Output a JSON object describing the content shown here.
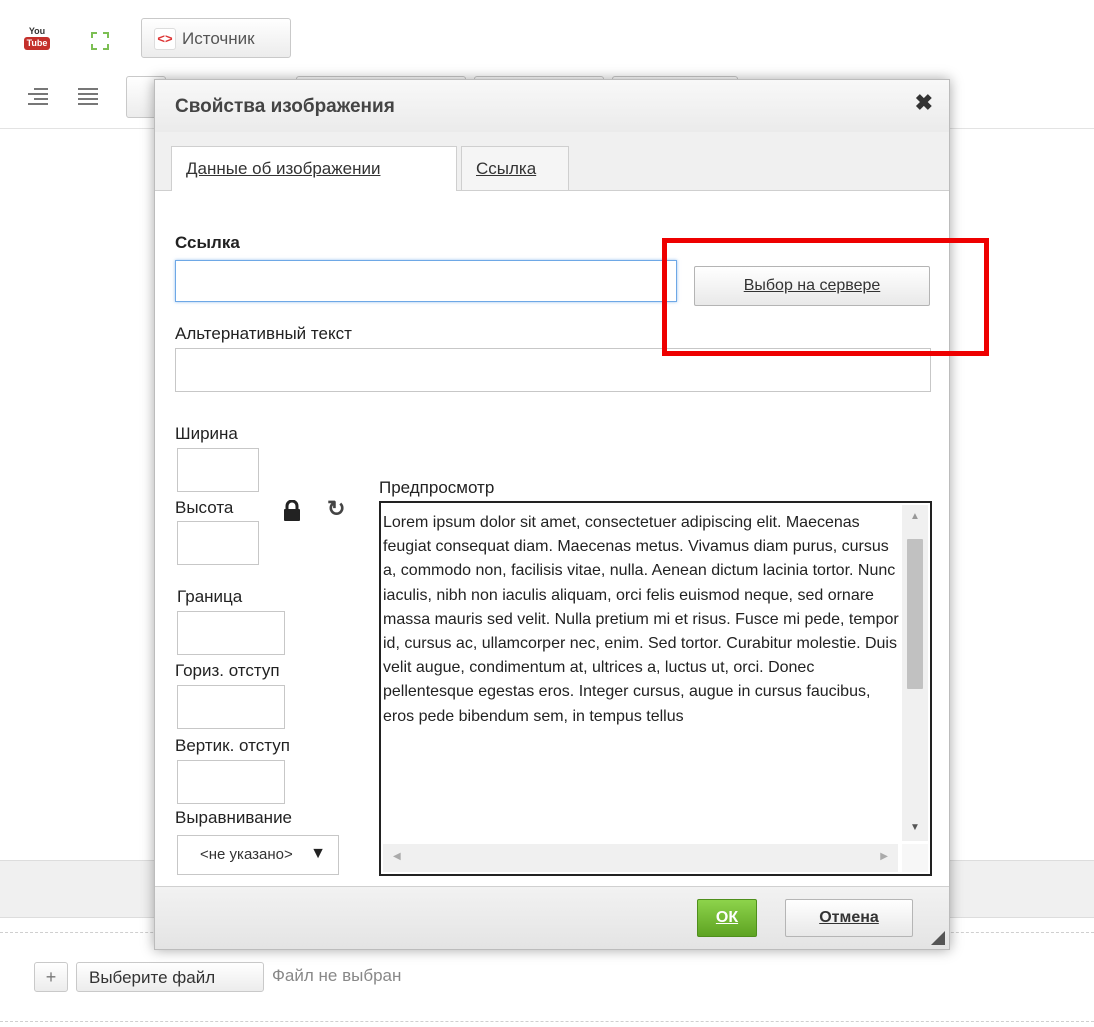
{
  "toolbar": {
    "youtube_top": "You",
    "youtube_bottom": "Tube",
    "source_glyph": "<>",
    "source_label": "Источник"
  },
  "dialog": {
    "title": "Свойства изображения",
    "close_glyph": "✖",
    "tabs": [
      {
        "label": "Данные об изображении",
        "active": true
      },
      {
        "label": "Ссылка",
        "active": false
      }
    ],
    "url_label": "Ссылка",
    "url_value": "",
    "browse_server_label": "Выбор на сервере",
    "alt_label": "Альтернативный текст",
    "alt_value": "",
    "width_label": "Ширина",
    "width_value": "",
    "height_label": "Высота",
    "height_value": "",
    "reset_glyph": "↻",
    "border_label": "Граница",
    "border_value": "",
    "hspace_label": "Гориз. отступ",
    "hspace_value": "",
    "vspace_label": "Вертик. отступ",
    "vspace_value": "",
    "align_label": "Выравнивание",
    "align_value": "<не указано>",
    "align_arrow": "▼",
    "preview_label": "Предпросмотр",
    "preview_text": "Lorem ipsum dolor sit amet, consectetuer adipiscing elit. Maecenas feugiat consequat diam. Maecenas metus. Vivamus diam purus, cursus a, commodo non, facilisis vitae, nulla. Aenean dictum lacinia tortor. Nunc iaculis, nibh non iaculis aliquam, orci felis euismod neque, sed ornare massa mauris sed velit. Nulla pretium mi et risus. Fusce mi pede, tempor id, cursus ac, ullamcorper nec, enim. Sed tortor. Curabitur molestie. Duis velit augue, condimentum at, ultrices a, luctus ut, orci. Donec pellentesque egestas eros. Integer cursus, augue in cursus faucibus, eros pede bibendum sem, in tempus tellus",
    "ok_label": "ОК",
    "cancel_label": "Отмена"
  },
  "file_upload": {
    "plus_label": "+",
    "choose_label": "Выберите файл",
    "status": "Файл не выбран"
  }
}
